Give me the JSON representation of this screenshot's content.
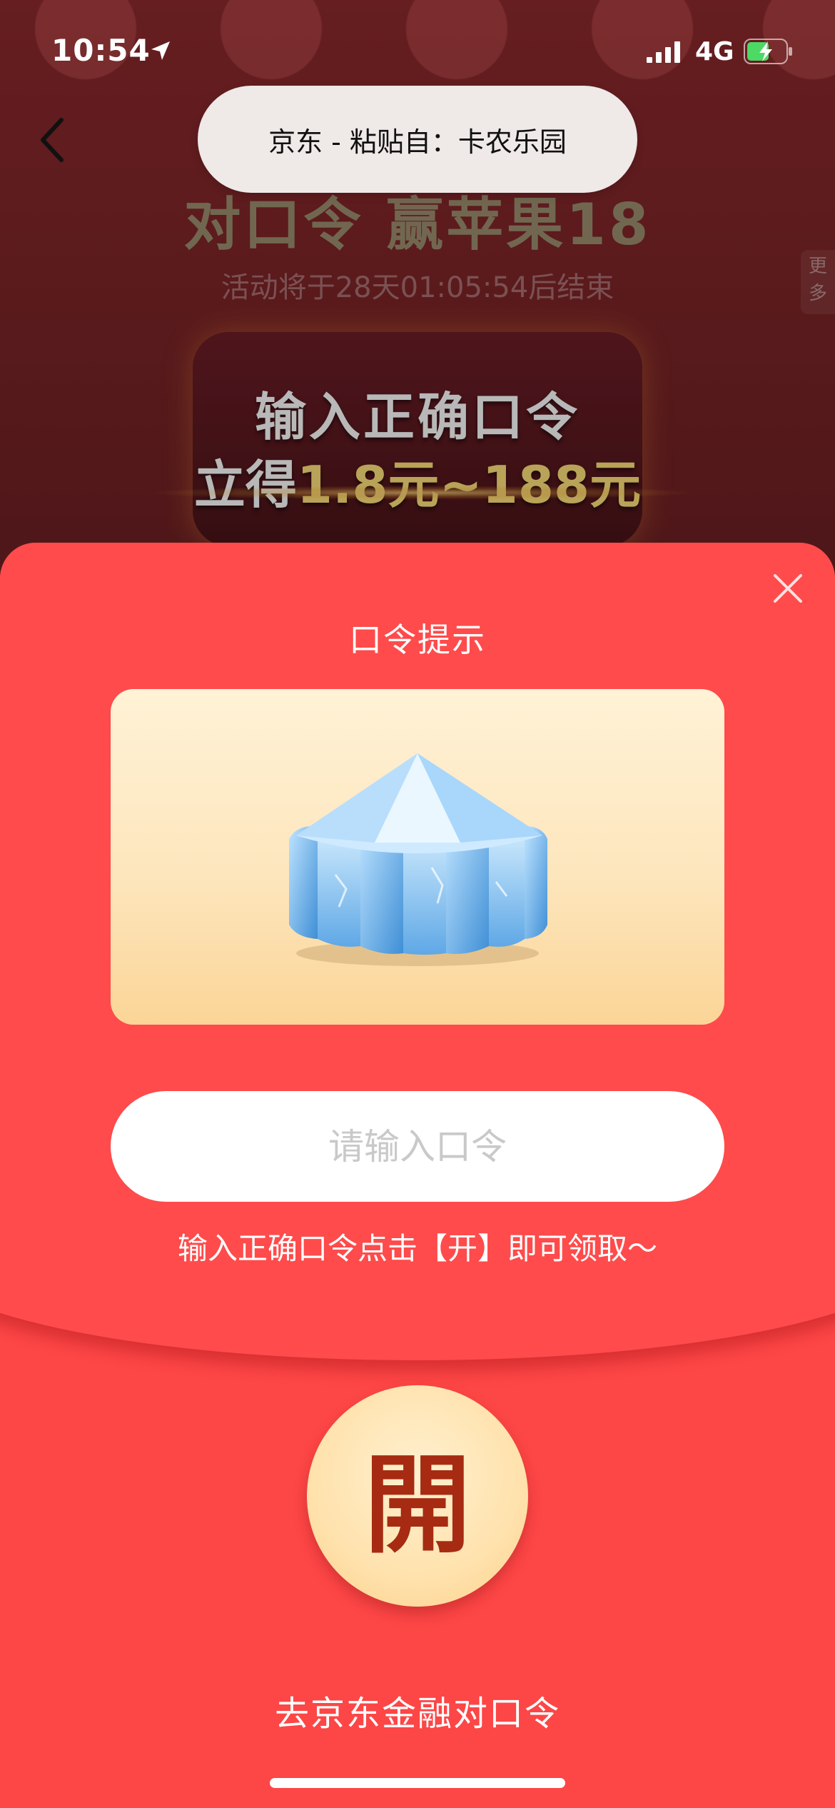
{
  "status_bar": {
    "time": "10:54",
    "network": "4G",
    "location_icon": "location-arrow-icon",
    "signal_icon": "signal-bars-icon",
    "battery_icon": "battery-charging-icon"
  },
  "background_page": {
    "title": "对口令 赢苹果18",
    "countdown": "活动将于28天01:05:54后结束",
    "more_tab": "更多",
    "banner_line1": "输入正确口令",
    "banner_line2_prefix": "立得",
    "banner_line2_amount": "1.8元~188元",
    "back_icon": "chevron-left-icon"
  },
  "paste_toast": {
    "text": "京东 - 粘贴自：卡农乐园"
  },
  "sheet": {
    "title": "口令提示",
    "hint_image_icon": "ice-crystal-icon",
    "input_placeholder": "请输入口令",
    "input_value": "",
    "instruction": "输入正确口令点击【开】即可领取～",
    "open_button_label": "開",
    "footer_link": "去京东金融对口令",
    "close_icon": "close-icon"
  },
  "colors": {
    "sheet_red": "#fd4646",
    "open_button_text": "#a62b12",
    "toast_bg": "#efe9e8"
  }
}
